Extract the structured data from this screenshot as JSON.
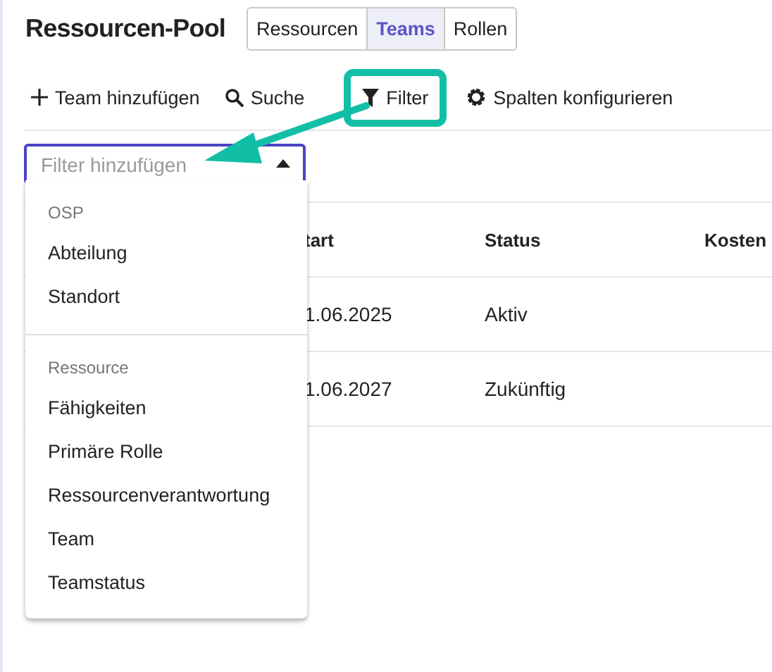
{
  "title": "Ressourcen-Pool",
  "tabs": [
    {
      "label": "Ressourcen",
      "selected": false
    },
    {
      "label": "Teams",
      "selected": true
    },
    {
      "label": "Rollen",
      "selected": false
    }
  ],
  "toolbar": [
    {
      "label": "Team hinzufügen",
      "kind": "plus"
    },
    {
      "label": "Suche",
      "kind": "search"
    },
    {
      "label": "Filter",
      "kind": "filter",
      "highlighted": true
    },
    {
      "label": "Spalten konfigurieren",
      "kind": "gear"
    }
  ],
  "filter_field": {
    "placeholder": "Filter hinzufügen",
    "expanded": true
  },
  "table": {
    "columns": [
      "tart",
      "Status",
      "Kosten"
    ],
    "rows": [
      [
        "1.06.2025",
        "Aktiv"
      ],
      [
        "1.06.2027",
        "Zukünftig"
      ]
    ]
  },
  "menu": {
    "groups": [
      {
        "heading": "OSP",
        "items": [
          "Abteilung",
          "Standort"
        ]
      },
      {
        "heading": "Ressource",
        "items": [
          "Fähigkeiten",
          "Primäre Rolle",
          "Ressourcenverantwortung",
          "Team",
          "Teamstatus"
        ]
      }
    ]
  }
}
